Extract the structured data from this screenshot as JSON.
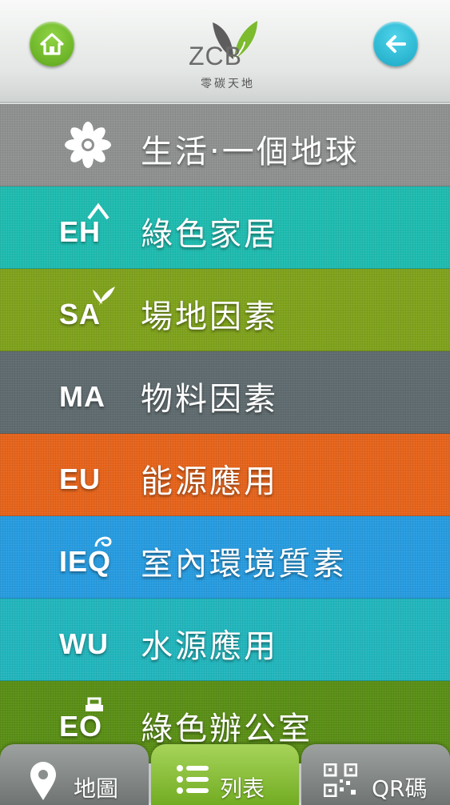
{
  "header": {
    "logo_text": "ZCB",
    "logo_subtitle": "零碳天地",
    "home_icon": "home-icon",
    "back_icon": "back-arrow-icon",
    "home_color": "#6cb526",
    "back_color": "#2bb7d2"
  },
  "menu": {
    "items": [
      {
        "label": "生活‧一個地球",
        "icon": "flower-icon",
        "color": "#8e9190"
      },
      {
        "label": "綠色家居",
        "abbr": "EH",
        "icon": "eh-house-icon",
        "color": "#1fbcb0"
      },
      {
        "label": "場地因素",
        "abbr": "SA",
        "icon": "sa-plant-icon",
        "color": "#7fa21c"
      },
      {
        "label": "物料因素",
        "abbr": "MA",
        "icon": "ma-recycle-icon",
        "color": "#5f6b6f"
      },
      {
        "label": "能源應用",
        "abbr": "EU",
        "icon": "eu-plug-icon",
        "color": "#e6641b"
      },
      {
        "label": "室內環境質素",
        "abbr": "IEQ",
        "icon": "ieq-swirl-icon",
        "color": "#279ce0"
      },
      {
        "label": "水源應用",
        "abbr": "WU",
        "icon": "wu-drop-icon",
        "color": "#22b6bd"
      },
      {
        "label": "綠色辦公室",
        "abbr": "EO",
        "icon": "eo-printer-icon",
        "color": "#5a8f16"
      }
    ]
  },
  "tabs": {
    "map_label": "地圖",
    "list_label": "列表",
    "qr_label": "QR碼",
    "map_icon": "map-pin-icon",
    "list_icon": "list-icon",
    "qr_icon": "qr-code-icon"
  }
}
